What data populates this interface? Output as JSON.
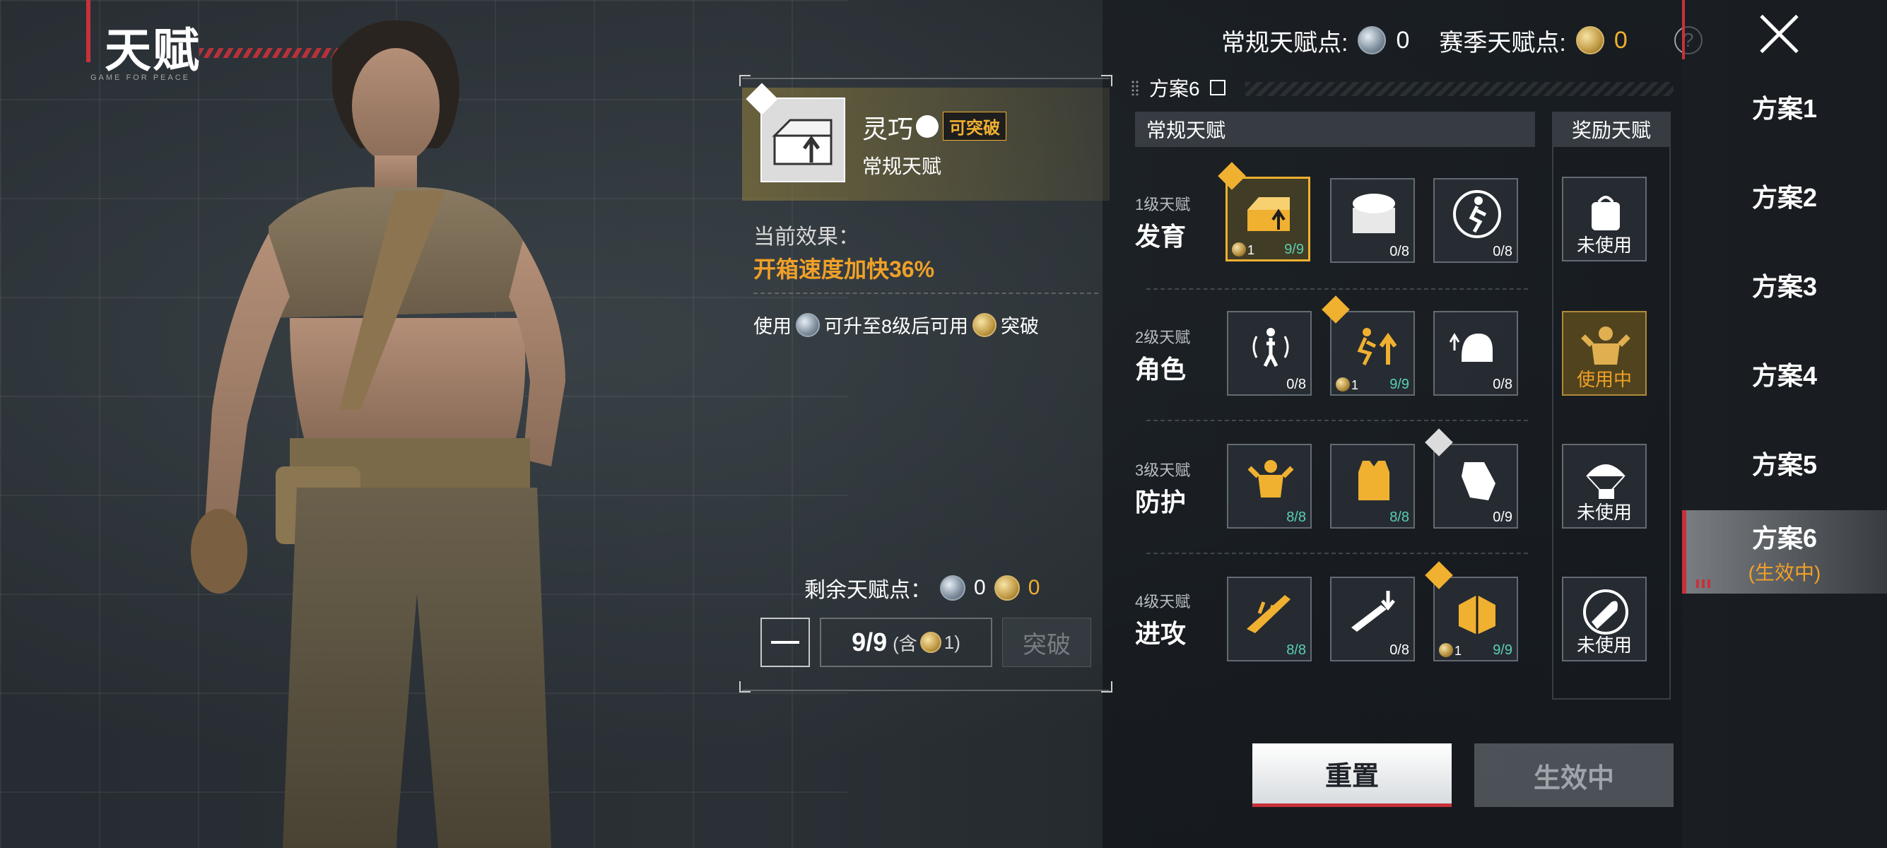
{
  "header": {
    "title": "天赋",
    "subtitle": "GAME FOR PEACE",
    "regular_points_label": "常规天赋点:",
    "regular_points_value": "0",
    "season_points_label": "赛季天赋点:",
    "season_points_value": "0"
  },
  "plans": {
    "items": [
      {
        "label": "方案1"
      },
      {
        "label": "方案2"
      },
      {
        "label": "方案3"
      },
      {
        "label": "方案4"
      },
      {
        "label": "方案5"
      },
      {
        "label": "方案6",
        "status": "(生效中)"
      }
    ]
  },
  "detail": {
    "talent_name": "灵巧",
    "can_break_label": "可突破",
    "talent_type": "常规天赋",
    "effect_label": "当前效果：",
    "effect_value": "开箱速度加快36%",
    "upgrade_note_prefix": "使用",
    "upgrade_note_middle": "可升至8级后可用",
    "upgrade_note_suffix": "突破",
    "remaining_label": "剩余天赋点：",
    "remaining_regular": "0",
    "remaining_season": "0",
    "level": "9/9",
    "contains_prefix": "(含",
    "contains_value": "1)",
    "break_button": "突破"
  },
  "grid": {
    "plan_name": "方案6",
    "regular_header": "常规天赋",
    "bonus_header": "奖励天赋",
    "tiers": [
      {
        "level": "1级天赋",
        "name": "发育",
        "slots": [
          {
            "icon": "crate-open-icon",
            "coin": "1",
            "progress": "9/9"
          },
          {
            "icon": "supply-box-icon",
            "progress": "0/8"
          },
          {
            "icon": "running-man-icon",
            "progress": "0/8"
          }
        ],
        "bonus": {
          "icon": "backpack-icon",
          "status": "未使用"
        }
      },
      {
        "level": "2级天赋",
        "name": "角色",
        "slots": [
          {
            "icon": "sound-wave-icon",
            "progress": "0/8"
          },
          {
            "icon": "sprint-icon",
            "coin": "1",
            "progress": "9/9"
          },
          {
            "icon": "helmet-up-icon",
            "progress": "0/8"
          }
        ],
        "bonus": {
          "icon": "strong-man-icon",
          "status": "使用中"
        }
      },
      {
        "level": "3级天赋",
        "name": "防护",
        "slots": [
          {
            "icon": "armor-man-icon",
            "progress": "8/8"
          },
          {
            "icon": "vest-icon",
            "progress": "8/8"
          },
          {
            "icon": "glove-icon",
            "progress": "0/9"
          }
        ],
        "bonus": {
          "icon": "airdrop-icon",
          "status": "未使用"
        }
      },
      {
        "level": "4级天赋",
        "name": "进攻",
        "slots": [
          {
            "icon": "rifle-icon",
            "progress": "8/8"
          },
          {
            "icon": "weapon-drop-icon",
            "progress": "0/8"
          },
          {
            "icon": "ammo-crate-icon",
            "coin": "1",
            "progress": "9/9"
          }
        ],
        "bonus": {
          "icon": "bullet-icon",
          "status": "未使用"
        }
      }
    ]
  },
  "buttons": {
    "reset": "重置",
    "active": "生效中"
  },
  "colors": {
    "accent_red": "#c8313a",
    "gold": "#f0b030",
    "orange": "#f0a028",
    "progress_full": "#5ad0b0"
  }
}
